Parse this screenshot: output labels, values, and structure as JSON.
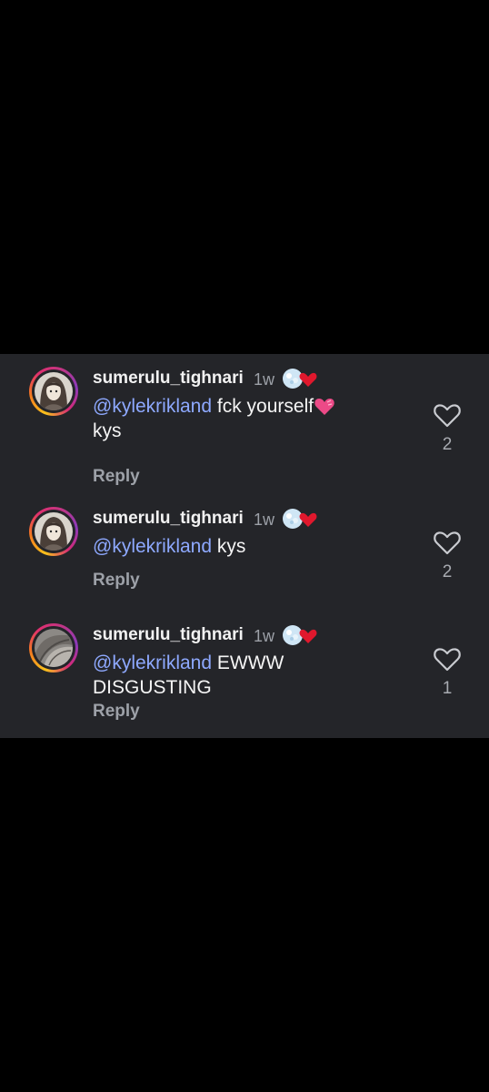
{
  "colors": {
    "background": "#000000",
    "panel": "#242529",
    "mention": "#8ea9ff",
    "muted": "#9da1a8",
    "text": "#f5f5f5"
  },
  "comments": [
    {
      "username": "sumerulu_tighnari",
      "time": "1w",
      "mention": "@kylekrikland",
      "text": " fck yourself",
      "text_after": "kys",
      "emoji": "pink-heart",
      "reply": "Reply",
      "likes": "2",
      "avatar": "anime-girl-avatar"
    },
    {
      "username": "sumerulu_tighnari",
      "time": "1w",
      "mention": "@kylekrikland",
      "text": " kys",
      "reply": "Reply",
      "likes": "2",
      "avatar": "anime-girl-avatar"
    },
    {
      "username": "sumerulu_tighnari",
      "time": "1w",
      "mention": "@kylekrikland",
      "text": " EWWW DISGUSTING",
      "reply": "Reply",
      "likes": "1",
      "avatar": "grey-hair-avatar"
    }
  ]
}
